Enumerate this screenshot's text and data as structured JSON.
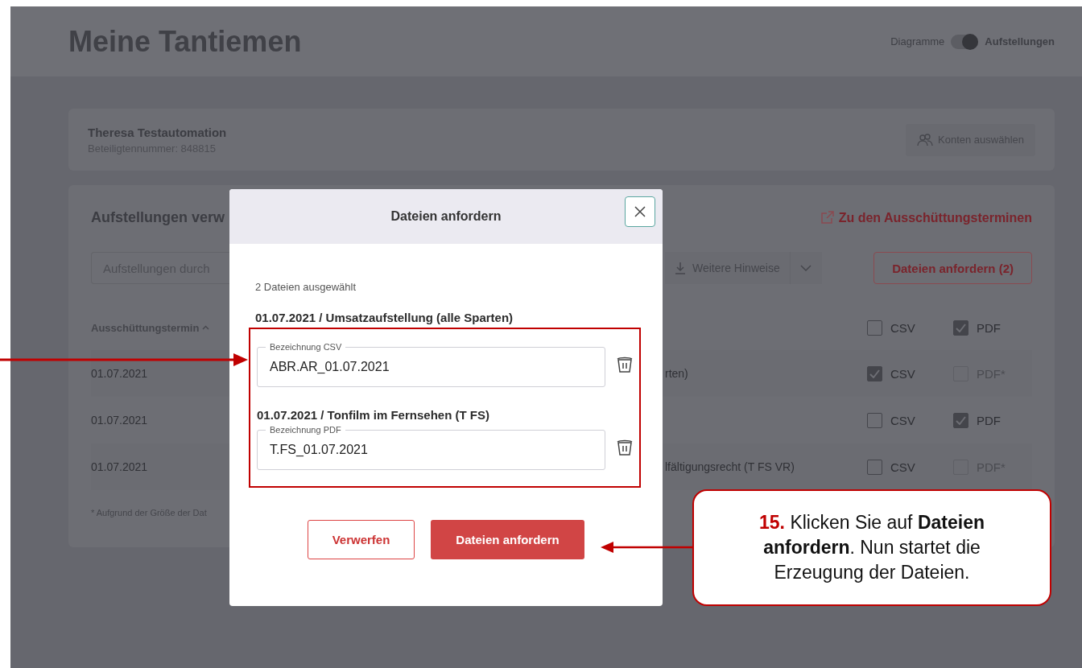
{
  "page": {
    "title": "Meine Tantiemen",
    "view_toggle": {
      "left_label": "Diagramme",
      "right_label": "Aufstellungen",
      "on": true
    }
  },
  "account": {
    "name": "Theresa Testautomation",
    "number": "Beteiligtennummer: 848815",
    "button": "Konten auswählen"
  },
  "statements": {
    "heading": "Aufstellungen verw",
    "link": "Zu den Ausschüttungsterminen",
    "search_placeholder": "Aufstellungen durch",
    "hints_button": "Weitere Hinweise",
    "request_button": "Dateien anfordern (2)",
    "date_column": "Ausschüttungstermin",
    "header_checks": {
      "csv": {
        "label": "CSV",
        "checked": false,
        "disabled": false
      },
      "pdf": {
        "label": "PDF",
        "checked": true,
        "disabled": false
      }
    },
    "rows": [
      {
        "date": "01.07.2021",
        "detail": "rten)",
        "csv": {
          "label": "CSV",
          "checked": true,
          "disabled": false
        },
        "pdf": {
          "label": "PDF*",
          "checked": false,
          "disabled": true
        }
      },
      {
        "date": "01.07.2021",
        "detail": "",
        "csv": {
          "label": "CSV",
          "checked": false,
          "disabled": false
        },
        "pdf": {
          "label": "PDF",
          "checked": true,
          "disabled": false
        }
      },
      {
        "date": "01.07.2021",
        "detail": "lfältigungsrecht (T FS VR)",
        "csv": {
          "label": "CSV",
          "checked": false,
          "disabled": false
        },
        "pdf": {
          "label": "PDF*",
          "checked": false,
          "disabled": true
        }
      }
    ],
    "footnote": "* Aufgrund der Größe der Dat"
  },
  "dialog": {
    "title": "Dateien anfordern",
    "selected_count": "2 Dateien ausgewählt",
    "files": [
      {
        "heading": "01.07.2021 / Umsatzaufstellung (alle Sparten)",
        "field_label": "Bezeichnung CSV",
        "value": "ABR.AR_01.07.2021"
      },
      {
        "heading": "01.07.2021 / Tonfilm im Fernsehen (T FS)",
        "field_label": "Bezeichnung PDF",
        "value": "T.FS_01.07.2021"
      }
    ],
    "discard_button": "Verwerfen",
    "confirm_button": "Dateien anfordern"
  },
  "callout": {
    "step": "15.",
    "text": "Klicken Sie auf **Dateien anfordern**. Nun startet die Erzeugung der Dateien."
  }
}
